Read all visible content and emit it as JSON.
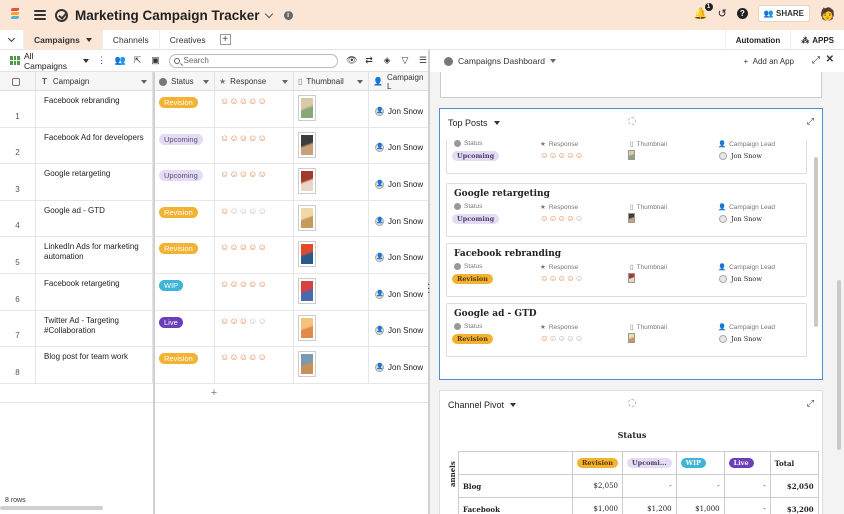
{
  "app": {
    "title": "Marketing Campaign Tracker",
    "notification_count": "1",
    "share_label": "SHARE"
  },
  "tabs": [
    {
      "label": "Campaigns",
      "active": true
    },
    {
      "label": "Channels",
      "active": false
    },
    {
      "label": "Creatives",
      "active": false
    }
  ],
  "tabbar_right": {
    "automation": "Automation",
    "apps": "APPS"
  },
  "grid_toolbar": {
    "view_name": "All Campaigns",
    "search_placeholder": "Search"
  },
  "grid": {
    "columns": [
      "Campaign",
      "Status",
      "Response",
      "Thumbnail",
      "Campaign L"
    ],
    "rows": [
      {
        "num": "1",
        "campaign": "Facebook rebranding",
        "status": "Revision",
        "rating": 5,
        "lead": "Jon Snow"
      },
      {
        "num": "2",
        "campaign": "Facebook Ad for developers",
        "status": "Upcoming",
        "rating": 5,
        "lead": "Jon Snow"
      },
      {
        "num": "3",
        "campaign": "Google retargeting",
        "status": "Upcoming",
        "rating": 5,
        "lead": "Jon Snow"
      },
      {
        "num": "4",
        "campaign": "Google ad - GTD",
        "status": "Revision",
        "rating": 1,
        "lead": "Jon Snow"
      },
      {
        "num": "5",
        "campaign": "LinkedIn Ads for marketing automation",
        "status": "Revision",
        "rating": 5,
        "lead": "Jon Snow"
      },
      {
        "num": "6",
        "campaign": "Facebook retargeting",
        "status": "WIP",
        "rating": 5,
        "lead": "Jon Snow"
      },
      {
        "num": "7",
        "campaign": "Twitter Ad - Targeting #Collaboration",
        "status": "Live",
        "rating": 3,
        "lead": "Jon Snow"
      },
      {
        "num": "8",
        "campaign": "Blog post for team work",
        "status": "Revision",
        "rating": 5,
        "lead": "Jon Snow"
      }
    ],
    "row_count": "8 rows"
  },
  "status_colors": {
    "Revision": {
      "bg": "#f2b233",
      "fg": "#ffffff"
    },
    "Upcoming": {
      "bg": "#e4dcf2",
      "fg": "#5a4a7a"
    },
    "WIP": {
      "bg": "#3fb4d6",
      "fg": "#ffffff"
    },
    "Live": {
      "bg": "#6a3fb8",
      "fg": "#ffffff"
    }
  },
  "dashboard": {
    "title": "Campaigns Dashboard",
    "add_app": "Add an App",
    "top_posts": {
      "title": "Top Posts",
      "field_labels": {
        "status": "Status",
        "response": "Response",
        "thumbnail": "Thumbnail",
        "lead": "Campaign Lead"
      },
      "posts": [
        {
          "title": "",
          "status": "Upcoming",
          "rating": 5,
          "lead": "Jon Snow"
        },
        {
          "title": "Google retargeting",
          "status": "Upcoming",
          "rating": 4,
          "lead": "Jon Snow"
        },
        {
          "title": "Facebook rebranding",
          "status": "Revision",
          "rating": 4,
          "lead": "Jon Snow"
        },
        {
          "title": "Google ad - GTD",
          "status": "Revision",
          "rating": 1,
          "lead": "Jon Snow"
        }
      ]
    },
    "pivot": {
      "title": "Channel Pivot",
      "status_heading": "Status",
      "row_axis_label": "annels",
      "columns": [
        "Revision",
        "Upcomi...",
        "WIP",
        "Live",
        "Total"
      ],
      "rows": [
        {
          "label": "Blog",
          "values": [
            "$2,050",
            "-",
            "-",
            "-",
            "$2,050"
          ]
        },
        {
          "label": "Facebook",
          "values": [
            "$1,000",
            "$1,200",
            "$1,000",
            "-",
            "$3,200"
          ]
        }
      ]
    }
  }
}
